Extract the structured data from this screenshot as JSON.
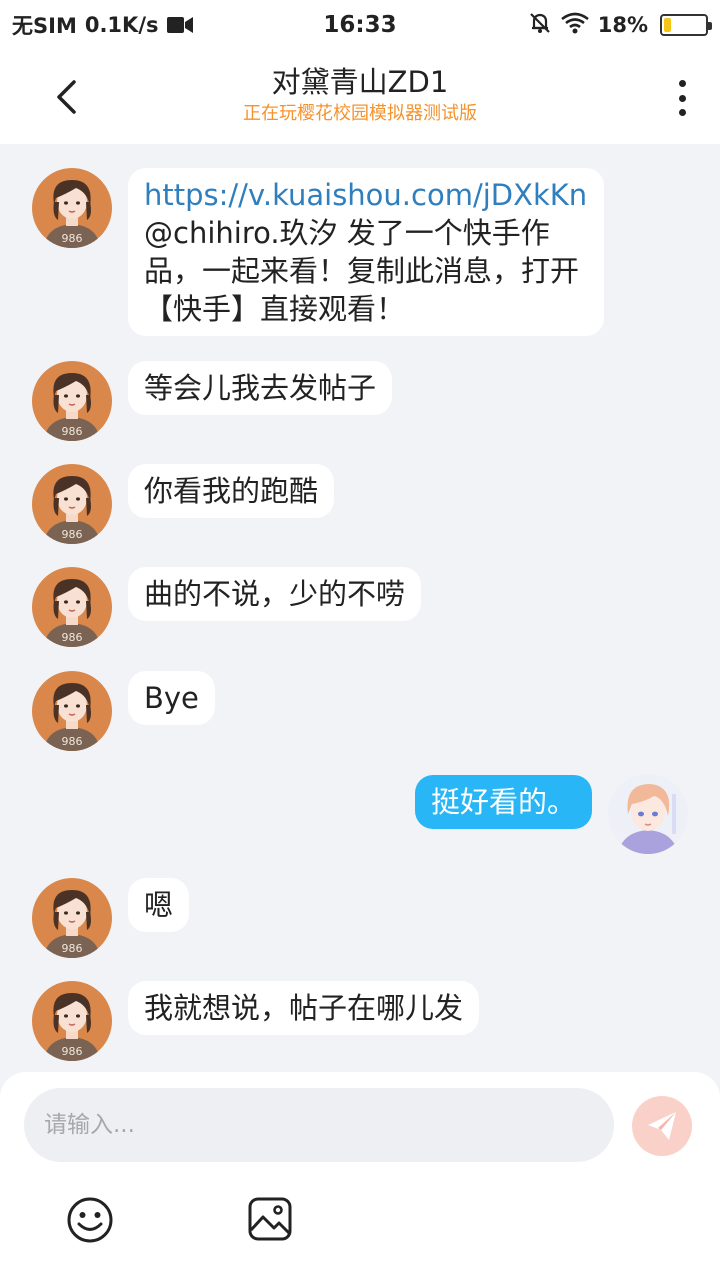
{
  "status_bar": {
    "carrier": "无SIM",
    "speed": "0.1K/s",
    "time": "16:33",
    "battery": "18%",
    "battery_level": 0.18
  },
  "header": {
    "title": "对黛青山ZD1",
    "subtitle": "正在玩樱花校园模拟器测试版",
    "subtitle_color": "#f5922b"
  },
  "messages": [
    {
      "side": "in",
      "link": "https://v.kuaishou.com/jDXkKn",
      "text": "@chihiro.玖汐 发了一个快手作品，一起来看！复制此消息，打开【快手】直接观看！"
    },
    {
      "side": "in",
      "text": "等会儿我去发帖子"
    },
    {
      "side": "in",
      "text": "你看我的跑酷"
    },
    {
      "side": "in",
      "text": "曲的不说，少的不唠"
    },
    {
      "side": "in",
      "text": "Bye"
    },
    {
      "side": "out",
      "text": "挺好看的。"
    },
    {
      "side": "in",
      "text": "嗯"
    },
    {
      "side": "in",
      "text": "我就想说，帖子在哪儿发"
    }
  ],
  "input": {
    "placeholder": "请输入..."
  },
  "icons": {
    "back": "back-arrow-icon",
    "more": "more-vertical-icon",
    "send": "send-icon",
    "emoji": "emoji-icon",
    "image": "image-icon",
    "mute": "mute-bell-icon",
    "wifi": "wifi-icon",
    "video": "video-camera-icon"
  },
  "colors": {
    "outgoing_bubble": "#29b6f6",
    "link": "#2f7fbf",
    "send_button": "#f9d1c9"
  }
}
